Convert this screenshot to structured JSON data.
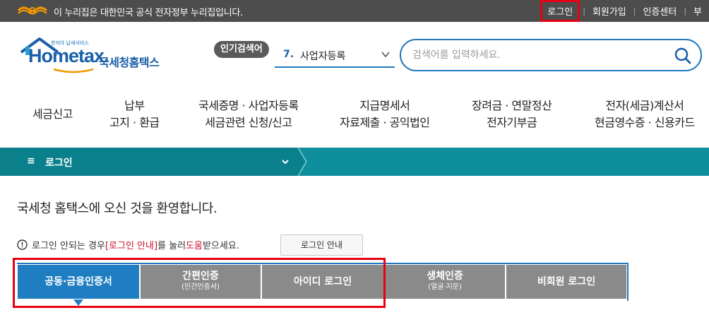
{
  "gov_banner": {
    "text": "이 누리집은 대한민국 공식 전자정부 누리집입니다.",
    "links": [
      "로그인",
      "회원가입",
      "인증센터",
      "부"
    ]
  },
  "logo": {
    "small_text": "한자야 납세서비스",
    "brand": "Hometax.",
    "brand_kr": "국세청홈택스"
  },
  "popular": {
    "badge": "인기검색어",
    "rank": "7.",
    "keyword": "사업자등록"
  },
  "search": {
    "placeholder": "검색어를 입력하세요."
  },
  "gnb": [
    {
      "line1": "세금신고",
      "line2": ""
    },
    {
      "line1": "납부",
      "line2": "고지 · 환급"
    },
    {
      "line1": "국세증명 · 사업자등록",
      "line2": "세금관련 신청/신고"
    },
    {
      "line1": "지급명세서",
      "line2": "자료제출 · 공익법인"
    },
    {
      "line1": "장려금 · 연말정산",
      "line2": "전자기부금"
    },
    {
      "line1": "전자(세금)계산서",
      "line2": "현금영수증 · 신용카드"
    }
  ],
  "navbar": {
    "menu_icon": "≡",
    "title": "로그인"
  },
  "welcome": "국세청 홈택스에 오신 것을 환영합니다.",
  "notice": {
    "part1": "로그인 안되는 경우 ",
    "link": "[로그인 안내]",
    "part2": "를 눌러 ",
    "help": "도움",
    "part3": "받으세요.",
    "button": "로그인 안내"
  },
  "tabs": [
    {
      "label": "공동·금융인증서",
      "sub": ""
    },
    {
      "label": "간편인증",
      "sub": "(민간인증서)"
    },
    {
      "label": "아이디 로그인",
      "sub": ""
    },
    {
      "label": "생체인증",
      "sub": "(얼굴·지문)"
    },
    {
      "label": "비회원 로그인",
      "sub": ""
    }
  ],
  "colors": {
    "gov_bar": "#4d4d4d",
    "brand_blue": "#1a5fa8",
    "teal": "#0e8f9b",
    "active_tab": "#1f7ec2",
    "inactive_tab": "#8a8a8a",
    "highlight": "#e60012"
  }
}
